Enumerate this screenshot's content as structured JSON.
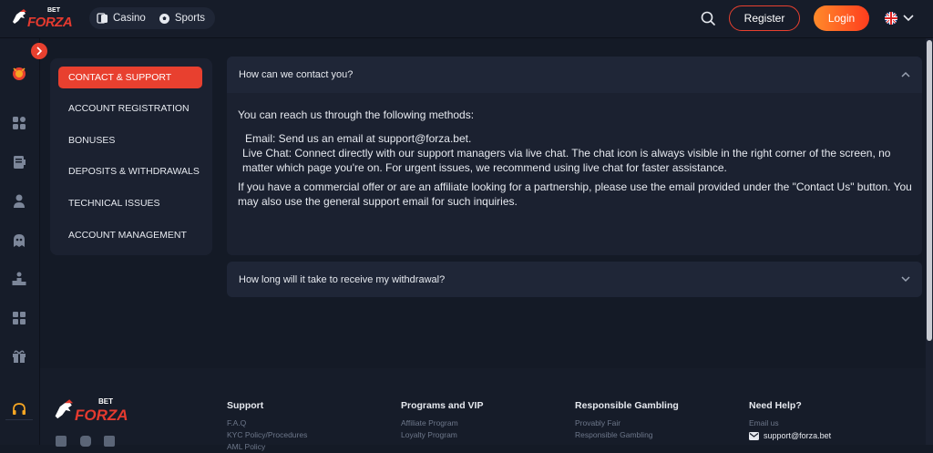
{
  "brand": {
    "bet": "BET",
    "forza": "FORZA"
  },
  "nav": {
    "casino": "Casino",
    "sports": "Sports"
  },
  "header": {
    "register": "Register",
    "login": "Login"
  },
  "categories": [
    "CONTACT & SUPPORT",
    "ACCOUNT REGISTRATION",
    "BONUSES",
    "DEPOSITS & WITHDRAWALS",
    "TECHNICAL ISSUES",
    "ACCOUNT MANAGEMENT"
  ],
  "faq": {
    "q1": "How can we contact you?",
    "intro": "You can reach us through the following methods:",
    "email_line": "Email: Send us an email at support@forza.bet.",
    "chat_line": "Live Chat: Connect directly with our support managers via live chat. The chat icon is always visible in the right corner of the screen, no matter   which page you're on. For urgent issues, we recommend using live chat for faster assistance.",
    "commercial": "If you have a commercial offer or are an affiliate looking for a partnership, please use the email provided under the \"Contact Us\" button. You may also use the general support email for such inquiries.",
    "q2": "How long will it take to receive my withdrawal?"
  },
  "footer": {
    "support": {
      "title": "Support",
      "links": [
        "F.A.Q",
        "KYC Policy/Procedures",
        "AML Policy"
      ]
    },
    "programs": {
      "title": "Programs and VIP",
      "links": [
        "Affiliate Program",
        "Loyalty Program"
      ]
    },
    "responsible": {
      "title": "Responsible Gambling",
      "links": [
        "Provably Fair",
        "Responsible Gambling"
      ]
    },
    "help": {
      "title": "Need Help?",
      "email_label": "Email us",
      "email": "support@forza.bet"
    }
  },
  "colors": {
    "accent": "#e8402f",
    "bg": "#141a26",
    "panel": "#1b2130"
  }
}
